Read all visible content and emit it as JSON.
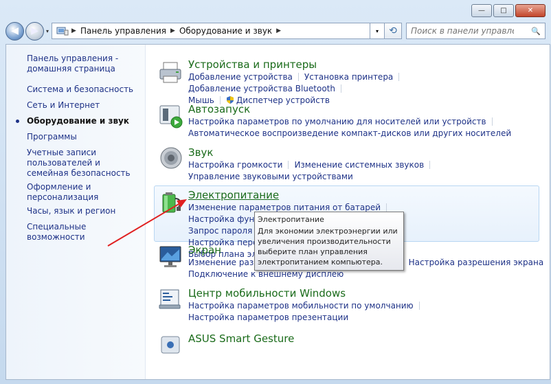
{
  "window": {
    "minimize_label": "—",
    "maximize_label": "□",
    "close_label": "✕"
  },
  "nav": {
    "back_glyph": "◀",
    "forward_glyph": "▶",
    "dropdown_glyph": "▾",
    "breadcrumb": [
      "Панель управления",
      "Оборудование и звук"
    ],
    "separator": "▶",
    "address_dropdown_glyph": "▾",
    "refresh_glyph": "⟲",
    "search_placeholder": "Поиск в панели управления",
    "search_glyph": "🔍"
  },
  "sidebar": {
    "items": [
      {
        "label": "Панель управления - домашняя страница"
      },
      {
        "label": "Система и безопасность"
      },
      {
        "label": "Сеть и Интернет"
      },
      {
        "label": "Оборудование и звук"
      },
      {
        "label": "Программы"
      },
      {
        "label": "Учетные записи пользователей и семейная безопасность"
      },
      {
        "label": "Оформление и персонализация"
      },
      {
        "label": "Часы, язык и регион"
      },
      {
        "label": "Специальные возможности"
      }
    ]
  },
  "categories": {
    "devices": {
      "title": "Устройства и принтеры",
      "links": [
        "Добавление устройства",
        "Установка принтера",
        "Добавление устройства Bluetooth",
        "Мышь",
        "Диспетчер устройств"
      ]
    },
    "autoplay": {
      "title": "Автозапуск",
      "links": [
        "Настройка параметров по умолчанию для носителей или устройств",
        "Автоматическое воспроизведение компакт-дисков или других носителей"
      ]
    },
    "sound": {
      "title": "Звук",
      "links": [
        "Настройка громкости",
        "Изменение системных звуков",
        "Управление звуковыми устройствами"
      ]
    },
    "power": {
      "title": "Электропитание",
      "links": [
        "Изменение параметров питания от батарей",
        "Настройка функций кнопок питания",
        "Запрос пароля п",
        "Настройка перехода в спящий режим",
        "Выбор плана эле"
      ]
    },
    "display": {
      "title": "Экран",
      "links": [
        "Изменение разме",
        "Настройка разрешения экрана",
        "Подключение к внешнему дисплею"
      ]
    },
    "mobility": {
      "title": "Центр мобильности Windows",
      "links": [
        "Настройка параметров мобильности по умолчанию",
        "Настройка параметров презентации"
      ]
    },
    "asus": {
      "title": "ASUS Smart Gesture"
    }
  },
  "tooltip": {
    "title": "Электропитание",
    "text": "Для экономии электроэнергии или увеличения производительности выберите план управления электропитанием компьютера."
  },
  "colors": {
    "category_title": "#1a6b1a",
    "link": "#1e3287",
    "annotation_arrow": "#e02020"
  }
}
